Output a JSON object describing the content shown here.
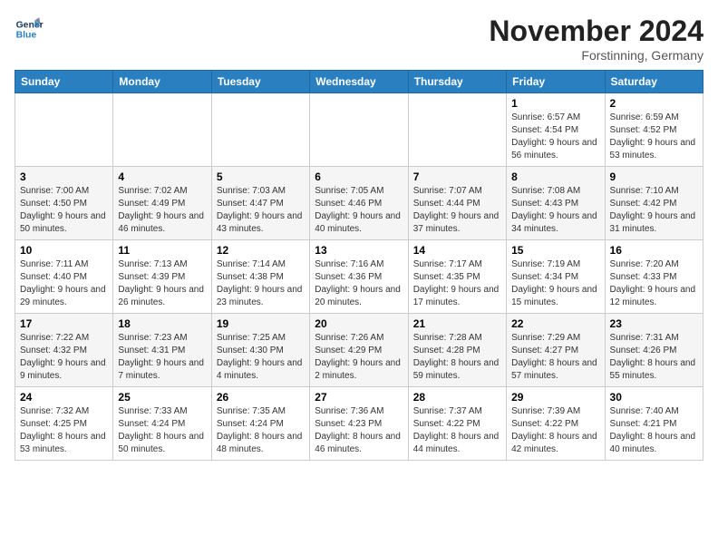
{
  "header": {
    "logo_line1": "General",
    "logo_line2": "Blue",
    "month_title": "November 2024",
    "location": "Forstinning, Germany"
  },
  "weekdays": [
    "Sunday",
    "Monday",
    "Tuesday",
    "Wednesday",
    "Thursday",
    "Friday",
    "Saturday"
  ],
  "weeks": [
    [
      {
        "day": "",
        "info": ""
      },
      {
        "day": "",
        "info": ""
      },
      {
        "day": "",
        "info": ""
      },
      {
        "day": "",
        "info": ""
      },
      {
        "day": "",
        "info": ""
      },
      {
        "day": "1",
        "info": "Sunrise: 6:57 AM\nSunset: 4:54 PM\nDaylight: 9 hours and 56 minutes."
      },
      {
        "day": "2",
        "info": "Sunrise: 6:59 AM\nSunset: 4:52 PM\nDaylight: 9 hours and 53 minutes."
      }
    ],
    [
      {
        "day": "3",
        "info": "Sunrise: 7:00 AM\nSunset: 4:50 PM\nDaylight: 9 hours and 50 minutes."
      },
      {
        "day": "4",
        "info": "Sunrise: 7:02 AM\nSunset: 4:49 PM\nDaylight: 9 hours and 46 minutes."
      },
      {
        "day": "5",
        "info": "Sunrise: 7:03 AM\nSunset: 4:47 PM\nDaylight: 9 hours and 43 minutes."
      },
      {
        "day": "6",
        "info": "Sunrise: 7:05 AM\nSunset: 4:46 PM\nDaylight: 9 hours and 40 minutes."
      },
      {
        "day": "7",
        "info": "Sunrise: 7:07 AM\nSunset: 4:44 PM\nDaylight: 9 hours and 37 minutes."
      },
      {
        "day": "8",
        "info": "Sunrise: 7:08 AM\nSunset: 4:43 PM\nDaylight: 9 hours and 34 minutes."
      },
      {
        "day": "9",
        "info": "Sunrise: 7:10 AM\nSunset: 4:42 PM\nDaylight: 9 hours and 31 minutes."
      }
    ],
    [
      {
        "day": "10",
        "info": "Sunrise: 7:11 AM\nSunset: 4:40 PM\nDaylight: 9 hours and 29 minutes."
      },
      {
        "day": "11",
        "info": "Sunrise: 7:13 AM\nSunset: 4:39 PM\nDaylight: 9 hours and 26 minutes."
      },
      {
        "day": "12",
        "info": "Sunrise: 7:14 AM\nSunset: 4:38 PM\nDaylight: 9 hours and 23 minutes."
      },
      {
        "day": "13",
        "info": "Sunrise: 7:16 AM\nSunset: 4:36 PM\nDaylight: 9 hours and 20 minutes."
      },
      {
        "day": "14",
        "info": "Sunrise: 7:17 AM\nSunset: 4:35 PM\nDaylight: 9 hours and 17 minutes."
      },
      {
        "day": "15",
        "info": "Sunrise: 7:19 AM\nSunset: 4:34 PM\nDaylight: 9 hours and 15 minutes."
      },
      {
        "day": "16",
        "info": "Sunrise: 7:20 AM\nSunset: 4:33 PM\nDaylight: 9 hours and 12 minutes."
      }
    ],
    [
      {
        "day": "17",
        "info": "Sunrise: 7:22 AM\nSunset: 4:32 PM\nDaylight: 9 hours and 9 minutes."
      },
      {
        "day": "18",
        "info": "Sunrise: 7:23 AM\nSunset: 4:31 PM\nDaylight: 9 hours and 7 minutes."
      },
      {
        "day": "19",
        "info": "Sunrise: 7:25 AM\nSunset: 4:30 PM\nDaylight: 9 hours and 4 minutes."
      },
      {
        "day": "20",
        "info": "Sunrise: 7:26 AM\nSunset: 4:29 PM\nDaylight: 9 hours and 2 minutes."
      },
      {
        "day": "21",
        "info": "Sunrise: 7:28 AM\nSunset: 4:28 PM\nDaylight: 8 hours and 59 minutes."
      },
      {
        "day": "22",
        "info": "Sunrise: 7:29 AM\nSunset: 4:27 PM\nDaylight: 8 hours and 57 minutes."
      },
      {
        "day": "23",
        "info": "Sunrise: 7:31 AM\nSunset: 4:26 PM\nDaylight: 8 hours and 55 minutes."
      }
    ],
    [
      {
        "day": "24",
        "info": "Sunrise: 7:32 AM\nSunset: 4:25 PM\nDaylight: 8 hours and 53 minutes."
      },
      {
        "day": "25",
        "info": "Sunrise: 7:33 AM\nSunset: 4:24 PM\nDaylight: 8 hours and 50 minutes."
      },
      {
        "day": "26",
        "info": "Sunrise: 7:35 AM\nSunset: 4:24 PM\nDaylight: 8 hours and 48 minutes."
      },
      {
        "day": "27",
        "info": "Sunrise: 7:36 AM\nSunset: 4:23 PM\nDaylight: 8 hours and 46 minutes."
      },
      {
        "day": "28",
        "info": "Sunrise: 7:37 AM\nSunset: 4:22 PM\nDaylight: 8 hours and 44 minutes."
      },
      {
        "day": "29",
        "info": "Sunrise: 7:39 AM\nSunset: 4:22 PM\nDaylight: 8 hours and 42 minutes."
      },
      {
        "day": "30",
        "info": "Sunrise: 7:40 AM\nSunset: 4:21 PM\nDaylight: 8 hours and 40 minutes."
      }
    ]
  ]
}
